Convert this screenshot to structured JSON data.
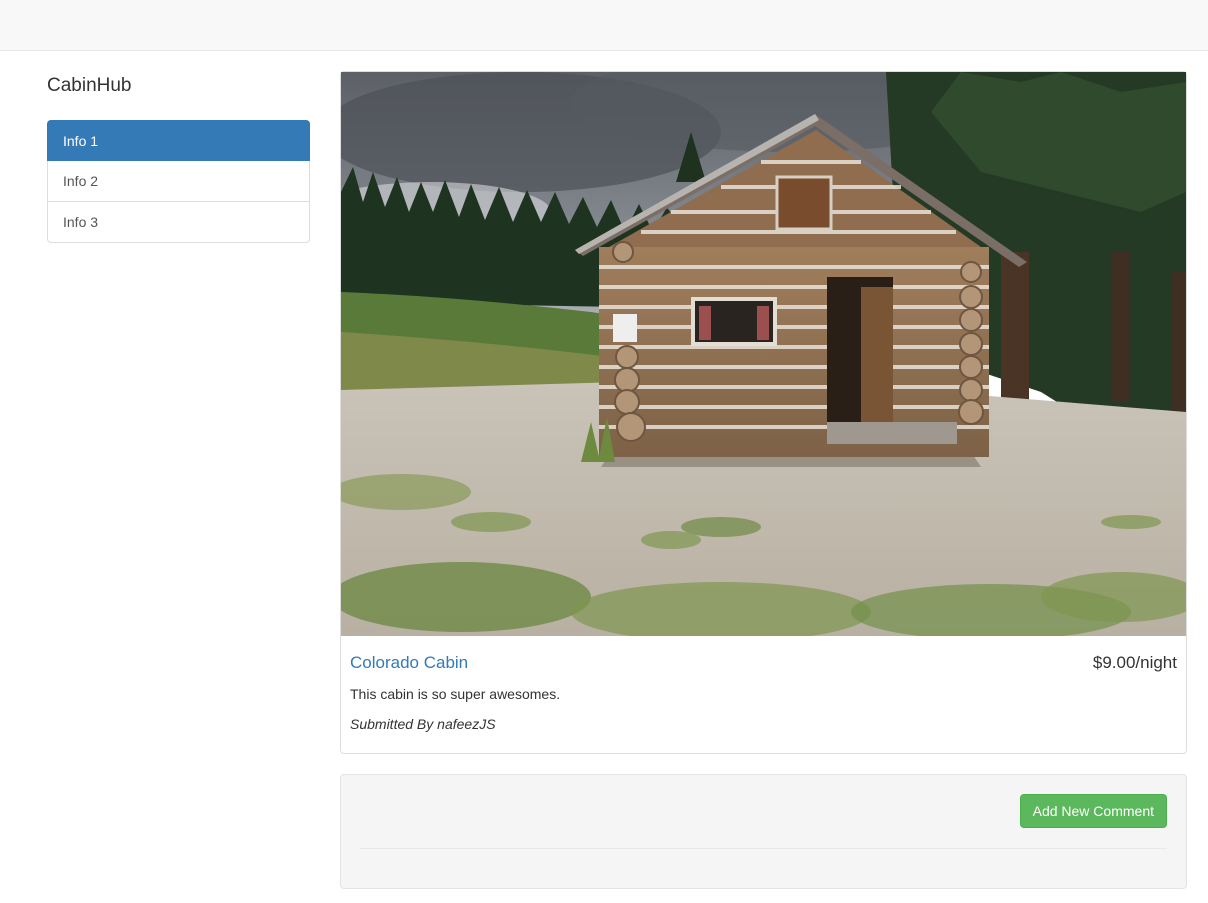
{
  "navbar": {},
  "sidebar": {
    "brand": "CabinHub",
    "items": [
      {
        "label": "Info 1",
        "active": true
      },
      {
        "label": "Info 2",
        "active": false
      },
      {
        "label": "Info 3",
        "active": false
      }
    ]
  },
  "cabin": {
    "title": "Colorado Cabin",
    "price": "$9.00/night",
    "description": "This cabin is so super awesomes.",
    "submitted_prefix": "Submitted By",
    "author": "nafeezJS"
  },
  "comments": {
    "add_button_label": "Add New Comment"
  },
  "colors": {
    "primary": "#337ab7",
    "success": "#5cb85c",
    "navbar_bg": "#f8f8f8",
    "well_bg": "#f5f5f5"
  }
}
